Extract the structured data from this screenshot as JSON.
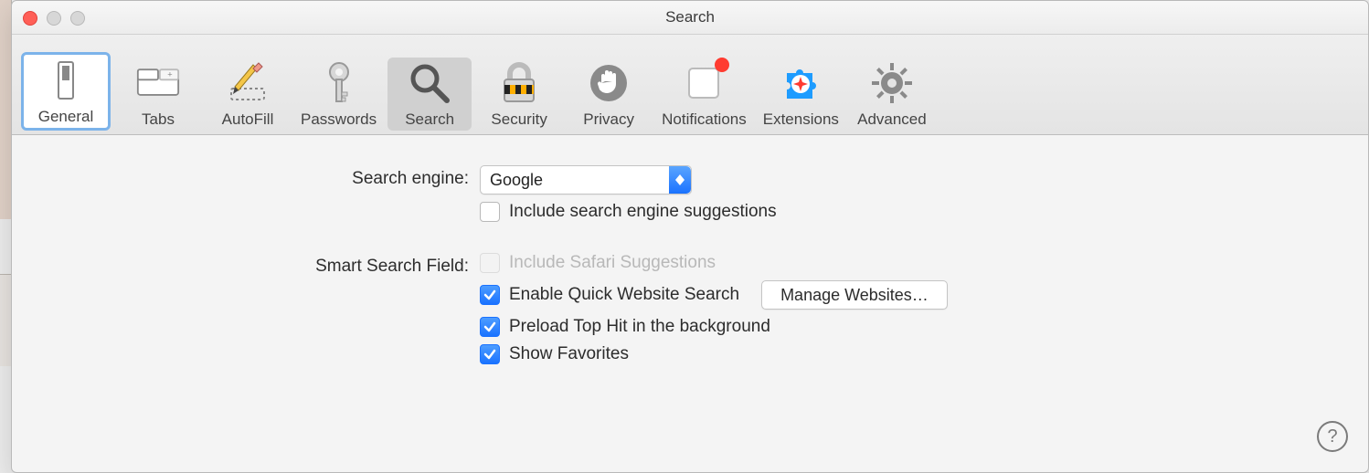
{
  "window": {
    "title": "Search"
  },
  "toolbar": {
    "items": [
      {
        "id": "general",
        "label": "General"
      },
      {
        "id": "tabs",
        "label": "Tabs"
      },
      {
        "id": "autofill",
        "label": "AutoFill"
      },
      {
        "id": "passwords",
        "label": "Passwords"
      },
      {
        "id": "search",
        "label": "Search"
      },
      {
        "id": "security",
        "label": "Security"
      },
      {
        "id": "privacy",
        "label": "Privacy"
      },
      {
        "id": "notifications",
        "label": "Notifications"
      },
      {
        "id": "extensions",
        "label": "Extensions"
      },
      {
        "id": "advanced",
        "label": "Advanced"
      }
    ],
    "selected": "general",
    "active": "search"
  },
  "search_engine": {
    "label": "Search engine:",
    "value": "Google",
    "suggestions_label": "Include search engine suggestions",
    "suggestions_checked": false
  },
  "smart_search": {
    "label": "Smart Search Field:",
    "safari_suggestions": {
      "label": "Include Safari Suggestions",
      "checked": false,
      "disabled": true
    },
    "quick_website": {
      "label": "Enable Quick Website Search",
      "checked": true
    },
    "manage_label": "Manage Websites…",
    "preload": {
      "label": "Preload Top Hit in the background",
      "checked": true
    },
    "favorites": {
      "label": "Show Favorites",
      "checked": true
    }
  },
  "help_label": "?"
}
